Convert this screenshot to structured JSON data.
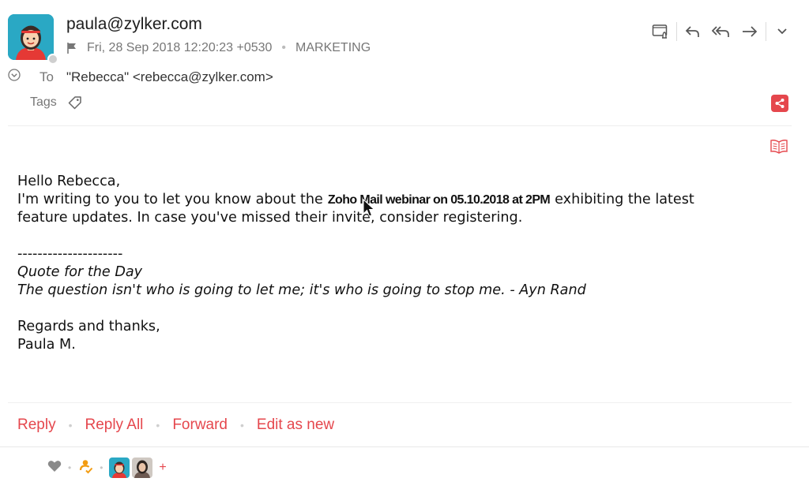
{
  "header": {
    "from": "paula@zylker.com",
    "date": "Fri, 28 Sep 2018 12:20:23 +0530",
    "folder": "MARKETING",
    "to_label": "To",
    "to_value": "\"Rebecca\" <rebecca@zylker.com>",
    "tags_label": "Tags"
  },
  "toolbar": {
    "icons": [
      "reminder-icon",
      "reply-icon",
      "reply-all-icon",
      "forward-icon",
      "more-icon"
    ]
  },
  "body": {
    "greeting": "Hello Rebecca,",
    "line1_pre": "I'm writing to you to let you know about the",
    "highlight": "Zoho Mail webinar on 05.10.2018 at 2PM",
    "line1_post": "exhibiting the latest",
    "line2": "feature updates. In case you've missed their invite, consider registering.",
    "separator": "---------------------",
    "quote_title": "Quote for the Day",
    "quote": "The question isn't who is going to let me; it's who is going to stop me. - Ayn Rand",
    "closing": "Regards and thanks,",
    "signature": "Paula M."
  },
  "actions": {
    "reply": "Reply",
    "reply_all": "Reply All",
    "forward": "Forward",
    "edit_as_new": "Edit as new"
  },
  "footer": {
    "add": "+"
  },
  "colors": {
    "accent": "#e5474d",
    "avatar_bg": "#2aa8c4",
    "muted": "#777777"
  }
}
